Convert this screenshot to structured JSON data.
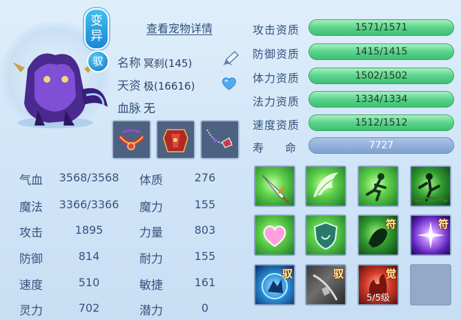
{
  "pet": {
    "variant_badge_top": "变",
    "variant_badge_bottom": "异",
    "tame_badge": "驭",
    "details_link": "查看宠物详情",
    "name_label": "名称",
    "name_value": "冥刹(145)",
    "talent_label": "天资",
    "talent_value": "极(16616)",
    "bloodline_label": "血脉",
    "bloodline_value": "无"
  },
  "aptitudes": [
    {
      "label": "攻击资质",
      "value": "1571/1571"
    },
    {
      "label": "防御资质",
      "value": "1415/1415"
    },
    {
      "label": "体力资质",
      "value": "1502/1502"
    },
    {
      "label": "法力资质",
      "value": "1334/1334"
    },
    {
      "label": "速度资质",
      "value": "1512/1512"
    }
  ],
  "lifespan": {
    "label_left": "寿",
    "label_right": "命",
    "value": "7727"
  },
  "stats_left": [
    {
      "label": "气血",
      "value": "3568/3568"
    },
    {
      "label": "魔法",
      "value": "3366/3366"
    },
    {
      "label": "攻击",
      "value": "1895"
    },
    {
      "label": "防御",
      "value": "814"
    },
    {
      "label": "速度",
      "value": "510"
    },
    {
      "label": "灵力",
      "value": "702"
    }
  ],
  "stats_right": [
    {
      "label": "体质",
      "value": "276"
    },
    {
      "label": "魔力",
      "value": "155"
    },
    {
      "label": "力量",
      "value": "803"
    },
    {
      "label": "耐力",
      "value": "155"
    },
    {
      "label": "敏捷",
      "value": "161"
    },
    {
      "label": "潜力",
      "value": "0"
    }
  ],
  "skills": {
    "tag_fu_1": "符",
    "tag_fu_2": "符",
    "tag_yu_1": "驭",
    "tag_yu_2": "驭",
    "tag_jue": "觉",
    "awaken_level": "5/5级"
  },
  "icons": [
    "pen-icon",
    "heart-icon",
    "equip-collar",
    "equip-armor",
    "equip-necklace"
  ],
  "colors": {
    "aptitude_bar": "#4fcf80",
    "lifespan_bar": "#8aa7d4",
    "background": "#d2e6f8"
  }
}
